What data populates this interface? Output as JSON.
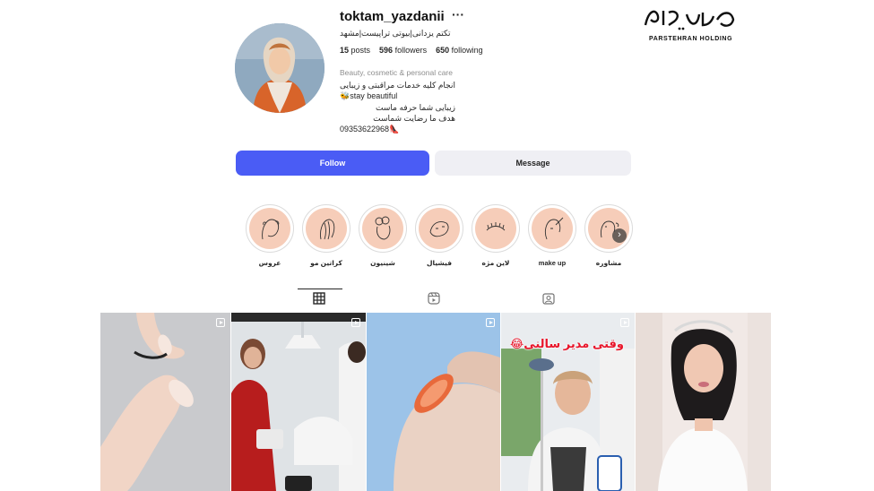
{
  "watermark": {
    "subtitle": "PARSTEHRAN HOLDING",
    "logo_lettering": "پارس تهران"
  },
  "profile": {
    "username": "toktam_yazdanii",
    "more_glyph": "···",
    "full_name": "تکتم یزدانی|بیوتی تراپیست|مشهد",
    "stats": {
      "posts_count": "15",
      "posts_label": "posts",
      "followers_count": "596",
      "followers_label": "followers",
      "following_count": "650",
      "following_label": "following"
    },
    "category": "Beauty, cosmetic & personal care",
    "bio_lines": [
      "انجام کلیه خدمات مراقبتی و زیبایی",
      "🐝stay beautiful",
      "زیبایی شما حرفه ماست",
      "هدف ما رضایت شماست",
      "09353622968👠"
    ]
  },
  "actions": {
    "follow_label": "Follow",
    "message_label": "Message"
  },
  "highlights": [
    {
      "label": "عروس"
    },
    {
      "label": "کراتین مو"
    },
    {
      "label": "شینیون"
    },
    {
      "label": "فیشیال"
    },
    {
      "label": "لاین مژه"
    },
    {
      "label": "make up"
    },
    {
      "label": "مشاوره"
    }
  ],
  "tabs": [
    {
      "name": "posts",
      "icon": "grid-icon",
      "active": true
    },
    {
      "name": "reels",
      "icon": "reels-icon",
      "active": false
    },
    {
      "name": "tagged",
      "icon": "tagged-icon",
      "active": false
    }
  ],
  "grid": {
    "posts": [
      {
        "type": "reel",
        "subject": "nails-hand"
      },
      {
        "type": "reel",
        "subject": "salon-manicure"
      },
      {
        "type": "reel",
        "subject": "nail-closeup"
      },
      {
        "type": "reel",
        "subject": "salon-manager",
        "overlay_text": "وقتی مدیر سالنی😂"
      },
      {
        "type": "post",
        "subject": "bridal-makeup"
      }
    ]
  },
  "colors": {
    "follow": "#4a5cf5",
    "message": "#efeff4",
    "highlight_bg": "#f6cdb9",
    "overlay_red": "#e8152a"
  }
}
